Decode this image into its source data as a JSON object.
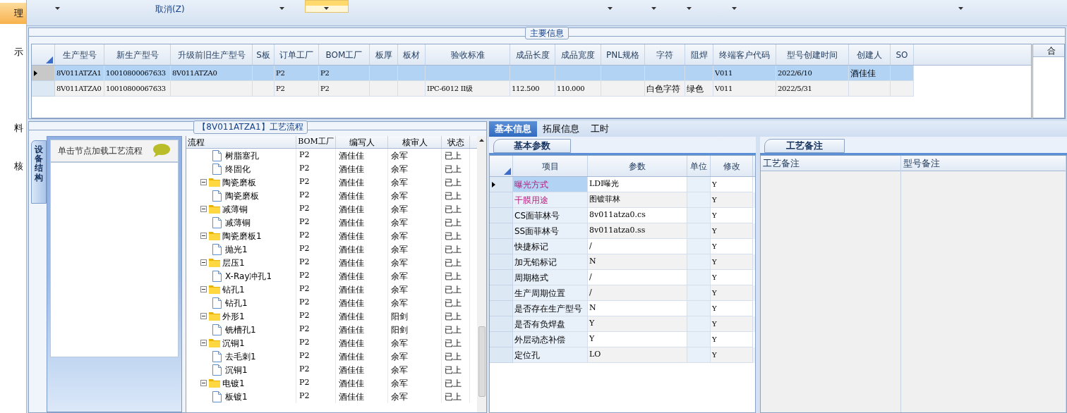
{
  "sidebar": {
    "items": [
      {
        "label": "理",
        "selected": true
      },
      {
        "label": "示",
        "selected": false
      },
      {
        "label": "料",
        "selected": false
      },
      {
        "label": "核",
        "selected": false
      }
    ]
  },
  "ribbon": {
    "cancel_label": "取消(Z)"
  },
  "main_info": {
    "title": "主要信息",
    "columns": [
      "生产型号",
      "新生产型号",
      "升级前旧生产型号",
      "S板",
      "订单工厂",
      "BOM工厂",
      "板厚",
      "板材",
      "验收标准",
      "成品长度",
      "成品宽度",
      "PNL规格",
      "字符",
      "阻焊",
      "终端客户代码",
      "型号创建时间",
      "创建人",
      "SO"
    ],
    "rows": [
      {
        "selected": true,
        "cells": [
          "8V011ATZA1",
          "10010800067633",
          "8V011ATZA0",
          "",
          "P2",
          "P2",
          "",
          "",
          "",
          "",
          "",
          "",
          "",
          "",
          "V011",
          "2022/6/10",
          "酒佳佳",
          ""
        ]
      },
      {
        "selected": false,
        "cells": [
          "8V011ATZA0",
          "10010800067633",
          "",
          "",
          "P2",
          "P2",
          "",
          "",
          "IPC-6012 II级",
          "112.500",
          "110.000",
          "",
          "白色字符",
          "绿色",
          "V011",
          "2022/5/31",
          "",
          ""
        ]
      }
    ],
    "side_column": "合"
  },
  "process": {
    "title": "【8V011ATZA1】工艺流程",
    "side_tab": "设备结构",
    "hint": "单击节点加载工艺流程",
    "columns": [
      "流程",
      "BOM工厂",
      "编写人",
      "核审人",
      "状态"
    ],
    "nodes": [
      {
        "children": [
          {
            "label": "树脂塞孔",
            "cells": [
              "P2",
              "酒佳佳",
              "余军",
              "已上"
            ]
          },
          {
            "label": "终固化",
            "cells": [
              "P2",
              "酒佳佳",
              "余军",
              "已上"
            ]
          }
        ]
      },
      {
        "label": "陶瓷磨板",
        "expanded": true,
        "cells": [
          "P2",
          "酒佳佳",
          "余军",
          "已上"
        ],
        "children": [
          {
            "label": "陶瓷磨板",
            "cells": [
              "P2",
              "酒佳佳",
              "余军",
              "已上"
            ]
          }
        ]
      },
      {
        "label": "减薄铜",
        "expanded": true,
        "cells": [
          "P2",
          "酒佳佳",
          "余军",
          "已上"
        ],
        "children": [
          {
            "label": "减薄铜",
            "cells": [
              "P2",
              "酒佳佳",
              "余军",
              "已上"
            ]
          }
        ]
      },
      {
        "label": "陶瓷磨板1",
        "expanded": true,
        "cells": [
          "P2",
          "酒佳佳",
          "余军",
          "已上"
        ],
        "children": [
          {
            "label": "抛光1",
            "cells": [
              "P2",
              "酒佳佳",
              "余军",
              "已上"
            ]
          }
        ]
      },
      {
        "label": "层压1",
        "expanded": true,
        "cells": [
          "P2",
          "酒佳佳",
          "余军",
          "已上"
        ],
        "children": [
          {
            "label": "X-Ray冲孔1",
            "cells": [
              "P2",
              "酒佳佳",
              "余军",
              "已上"
            ]
          }
        ]
      },
      {
        "label": "钻孔1",
        "expanded": true,
        "cells": [
          "P2",
          "酒佳佳",
          "余军",
          "已上"
        ],
        "children": [
          {
            "label": "钻孔1",
            "cells": [
              "P2",
              "酒佳佳",
              "余军",
              "已上"
            ]
          }
        ]
      },
      {
        "label": "外形1",
        "expanded": true,
        "cells": [
          "P2",
          "酒佳佳",
          "阳剑",
          "已上"
        ],
        "children": [
          {
            "label": "铣槽孔1",
            "cells": [
              "P2",
              "酒佳佳",
              "阳剑",
              "已上"
            ]
          }
        ]
      },
      {
        "label": "沉铜1",
        "expanded": true,
        "cells": [
          "P2",
          "酒佳佳",
          "余军",
          "已上"
        ],
        "children": [
          {
            "label": "去毛刺1",
            "cells": [
              "P2",
              "酒佳佳",
              "余军",
              "已上"
            ]
          },
          {
            "label": "沉铜1",
            "cells": [
              "P2",
              "酒佳佳",
              "余军",
              "已上"
            ]
          }
        ]
      },
      {
        "label": "电镀1",
        "expanded": true,
        "cells": [
          "P2",
          "酒佳佳",
          "余军",
          "已上"
        ],
        "children": [
          {
            "label": "板镀1",
            "cells": [
              "P2",
              "酒佳佳",
              "余军",
              "已上"
            ]
          }
        ]
      }
    ]
  },
  "detail": {
    "tabs": [
      {
        "label": "基本信息",
        "selected": true
      },
      {
        "label": "拓展信息",
        "selected": false
      },
      {
        "label": "工时",
        "selected": false
      }
    ],
    "sub_tab": "基本参数",
    "columns": [
      "项目",
      "参数",
      "单位",
      "修改"
    ],
    "rows": [
      {
        "selected": true,
        "highlighted": true,
        "item": "曝光方式",
        "value": "LDI曝光",
        "unit": "",
        "modify": "Y"
      },
      {
        "selected": false,
        "highlighted": true,
        "item": "干膜用途",
        "value": "图镀菲林",
        "unit": "",
        "modify": "Y"
      },
      {
        "selected": false,
        "highlighted": false,
        "item": "CS面菲林号",
        "value": "8v011atza0.cs",
        "unit": "",
        "modify": "Y"
      },
      {
        "selected": false,
        "highlighted": false,
        "item": "SS面菲林号",
        "value": "8v011atza0.ss",
        "unit": "",
        "modify": "Y"
      },
      {
        "selected": false,
        "highlighted": false,
        "item": "快捷标记",
        "value": "/",
        "unit": "",
        "modify": "Y"
      },
      {
        "selected": false,
        "highlighted": false,
        "item": "加无铅标记",
        "value": "N",
        "unit": "",
        "modify": "Y"
      },
      {
        "selected": false,
        "highlighted": false,
        "item": "周期格式",
        "value": "/",
        "unit": "",
        "modify": "Y"
      },
      {
        "selected": false,
        "highlighted": false,
        "item": "生产周期位置",
        "value": "/",
        "unit": "",
        "modify": "Y"
      },
      {
        "selected": false,
        "highlighted": false,
        "item": "是否存在生产型号",
        "value": "N",
        "unit": "",
        "modify": "Y"
      },
      {
        "selected": false,
        "highlighted": false,
        "item": "是否有负焊盘",
        "value": "Y",
        "unit": "",
        "modify": "Y"
      },
      {
        "selected": false,
        "highlighted": false,
        "item": "外层动态补偿",
        "value": "Y",
        "unit": "",
        "modify": "Y"
      },
      {
        "selected": false,
        "highlighted": false,
        "item": "定位孔",
        "value": "LO",
        "unit": "",
        "modify": "Y"
      }
    ]
  },
  "remarks": {
    "tab": "工艺备注",
    "columns": [
      "工艺备注",
      "型号备注"
    ]
  }
}
